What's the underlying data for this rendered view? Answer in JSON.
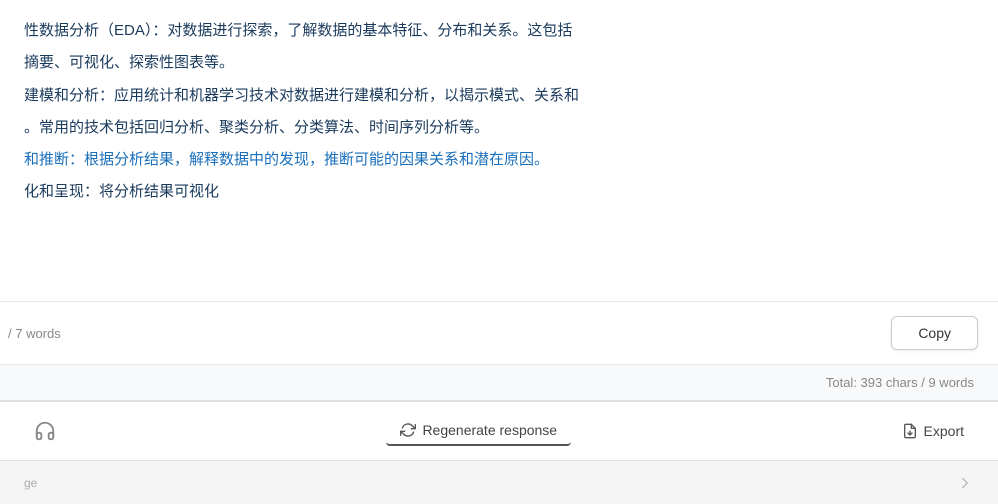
{
  "content": {
    "paragraphs": [
      {
        "text": "性数据分析（EDA）：对数据进行探索，了解数据的基本特征、分布和关系。这包括",
        "style": "normal"
      },
      {
        "text": "摘要、可视化、探索性图表等。",
        "style": "normal"
      },
      {
        "text": "建模和分析：应用统计和机器学习技术对数据进行建模和分析，以揭示模式、关系和",
        "style": "normal"
      },
      {
        "text": "。常用的技术包括回归分析、聚类分析、分类算法、时间序列分析等。",
        "style": "normal"
      },
      {
        "text": "和推断：根据分析结果，解释数据中的发现，推断可能的因果关系和潜在原因。",
        "style": "link"
      },
      {
        "text": "化和呈现：将分析结果可视化",
        "style": "normal"
      }
    ],
    "word_count_label": "/ 7 words",
    "copy_button_label": "Copy",
    "total_stats": "Total: 393 chars / 9 words"
  },
  "toolbar": {
    "regenerate_label": "Regenerate response",
    "export_label": "Export",
    "icons": {
      "headphone": "headphone-icon",
      "refresh": "refresh-icon",
      "export": "export-icon",
      "arrow": "arrow-icon"
    }
  },
  "footer": {
    "text": "ge"
  }
}
